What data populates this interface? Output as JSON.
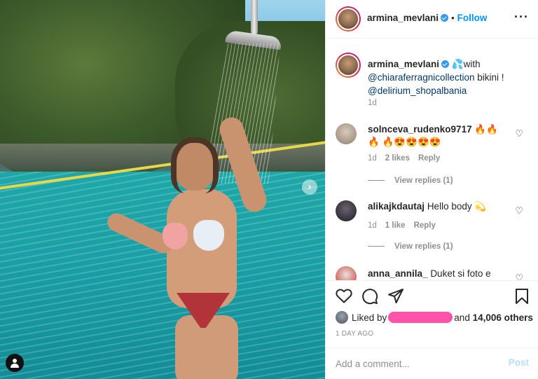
{
  "header": {
    "username": "armina_mevlani",
    "separator": "•",
    "follow_label": "Follow",
    "more_icon": "more-horizontal-icon"
  },
  "caption": {
    "username": "armina_mevlani",
    "emoji": "💦",
    "text_with": "with",
    "mention1": "@chiaraferragnicollection",
    "text_mid": " bikini !",
    "mention2": "@delirium_shopalbania",
    "time": "1d"
  },
  "comments": [
    {
      "username": "solnceva_rudenko9717",
      "text": "🔥🔥🔥 🔥😍😍😍😍",
      "time": "1d",
      "likes": "2 likes",
      "reply": "Reply",
      "view_replies": "View replies (1)",
      "avatar_color": "#b8a99a"
    },
    {
      "username": "alikajkdautaj",
      "text": "Hello body 💫",
      "time": "1d",
      "likes": "1 like",
      "reply": "Reply",
      "view_replies": "View replies (1)",
      "avatar_color": "#2b2b33"
    },
    {
      "username": "anna_annila_",
      "text": "Duket si foto e",
      "avatar_color": "#c8302f"
    }
  ],
  "actions": {
    "like_icon": "heart-icon",
    "comment_icon": "comment-icon",
    "share_icon": "send-icon",
    "save_icon": "bookmark-icon",
    "liked_by_prefix": "Liked by",
    "liked_by_and": "and",
    "liked_count": "14,006 others",
    "post_time": "1 DAY AGO"
  },
  "add_comment": {
    "placeholder": "Add a comment...",
    "post_label": "Post"
  },
  "colors": {
    "accent": "#0095f6",
    "post_disabled": "#b2dffc",
    "muted": "#8e8e8e",
    "mention": "#00376b",
    "redaction": "#ff3fa0"
  }
}
